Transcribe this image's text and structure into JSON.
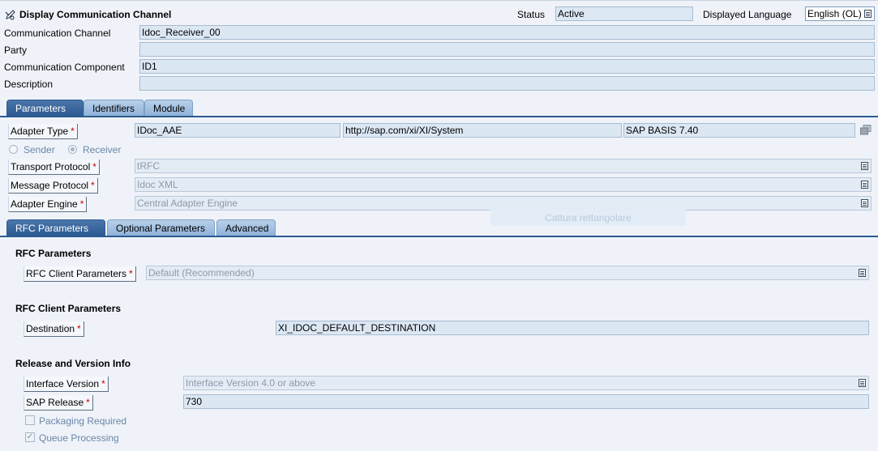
{
  "header": {
    "title": "Display Communication Channel",
    "status_label": "Status",
    "status_value": "Active",
    "language_label": "Displayed Language",
    "language_value": "English (OL)"
  },
  "general": {
    "channel_label": "Communication Channel",
    "channel_value": "Idoc_Receiver_00",
    "party_label": "Party",
    "party_value": "",
    "component_label": "Communication Component",
    "component_value": "ID1",
    "description_label": "Description",
    "description_value": ""
  },
  "main_tabs": [
    "Parameters",
    "Identifiers",
    "Module"
  ],
  "adapter": {
    "type_label": "Adapter Type",
    "type_value": "IDoc_AAE",
    "namespace_value": "http://sap.com/xi/XI/System",
    "swc_value": "SAP BASIS 7.40",
    "sender_label": "Sender",
    "receiver_label": "Receiver",
    "direction_selected": "Receiver",
    "transport_label": "Transport Protocol",
    "transport_value": "tRFC",
    "message_label": "Message Protocol",
    "message_value": "Idoc XML",
    "engine_label": "Adapter Engine",
    "engine_value": "Central Adapter Engine",
    "required_marker": "*"
  },
  "overlay_text": "Cattura rettangolare",
  "sub_tabs": [
    "RFC Parameters",
    "Optional Parameters",
    "Advanced"
  ],
  "rfc": {
    "section1_title": "RFC Parameters",
    "client_params_label": "RFC Client Parameters",
    "client_params_value": "Default (Recommended)",
    "section2_title": "RFC Client Parameters",
    "destination_label": "Destination",
    "destination_value": "XI_IDOC_DEFAULT_DESTINATION",
    "section3_title": "Release and Version Info",
    "interface_label": "Interface Version",
    "interface_value": "Interface Version 4.0 or above",
    "release_label": "SAP Release",
    "release_value": "730",
    "packaging_label": "Packaging Required",
    "packaging_checked": false,
    "queue_label": "Queue Processing",
    "queue_checked": true
  },
  "colors": {
    "active_tab": "#2c5a92",
    "required": "#cc0000",
    "field_bg": "#dce7f4"
  }
}
